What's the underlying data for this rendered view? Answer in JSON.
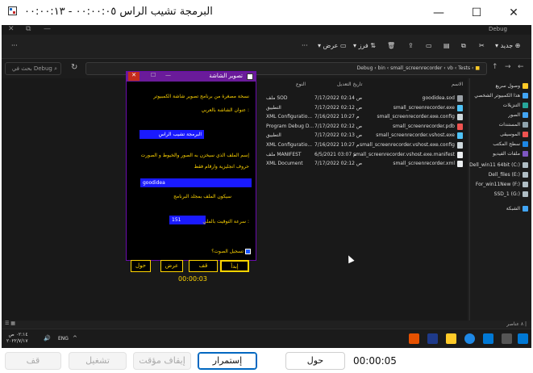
{
  "app": {
    "title": "البرمجة تشيب الراس ٠٠:٠٠:٠٥ - ٠٠:٠٠:١٣",
    "minimize": "—",
    "maximize": "☐",
    "close": "✕"
  },
  "explorer": {
    "tab_title": "Debug",
    "search_placeholder": "بحث في Debug",
    "breadcrumbs": [
      "Debug",
      "bin",
      "small_screenrecorder",
      "vb",
      "Tests"
    ],
    "toolbar": {
      "new_label": "جديد",
      "sort_label": "فرز",
      "view_label": "عرض"
    },
    "columns": {
      "name": "الاسم",
      "modified": "تاريخ التعديل",
      "type": "النوع"
    },
    "files": [
      {
        "name": "goodidea.sod",
        "date": "7/17/2022 02:14 ص",
        "type": "ملف SOD",
        "color": "#9aa0a6"
      },
      {
        "name": "small_screenrecorder.exe",
        "date": "7/17/2022 02:12 ص",
        "type": "التطبيق",
        "color": "#4fc3f7"
      },
      {
        "name": "small_screenrecorder.exe.config",
        "date": "7/16/2022 10:27 م",
        "type": "XML Configuratio...",
        "color": "#cfd8dc"
      },
      {
        "name": "small_screenrecorder.pdb",
        "date": "7/17/2022 02:12 ص",
        "type": "Program Debug D...",
        "color": "#ef5350"
      },
      {
        "name": "small_screenrecorder.vshost.exe",
        "date": "7/17/2022 02:13 ص",
        "type": "التطبيق",
        "color": "#4fc3f7"
      },
      {
        "name": "small_screenrecorder.vshost.exe.config",
        "date": "7/16/2022 10:27 م",
        "type": "XML Configuratio...",
        "color": "#cfd8dc"
      },
      {
        "name": "small_screenrecorder.vshost.exe.manifest",
        "date": "6/5/2021 03:07 م",
        "type": "ملف MANIFEST",
        "color": "#eceff1"
      },
      {
        "name": "small_screenrecorder.xml",
        "date": "7/17/2022 02:12 ص",
        "type": "XML Document",
        "color": "#eceff1"
      }
    ],
    "nav_items": [
      {
        "label": "وصول سريع",
        "color": "#ffca28"
      },
      {
        "label": "هذا الكمبيوتر الشخصي",
        "color": "#42a5f5"
      },
      {
        "label": "التنزيلات",
        "color": "#26a69a"
      },
      {
        "label": "الصور",
        "color": "#42a5f5"
      },
      {
        "label": "المستندات",
        "color": "#90a4ae"
      },
      {
        "label": "الموسيقى",
        "color": "#ef5350"
      },
      {
        "label": "سطح المكتب",
        "color": "#1e88e5"
      },
      {
        "label": "ملفات الفيديو",
        "color": "#7e57c2"
      },
      {
        "label": "Dell_win11 64bit (C:)",
        "color": "#b0bec5"
      },
      {
        "label": "Dell_files (E:)",
        "color": "#b0bec5"
      },
      {
        "label": "For_win11New (F:)",
        "color": "#b0bec5"
      },
      {
        "label": "SSD_1 (G:)",
        "color": "#b0bec5"
      },
      {
        "label": "الشبكة",
        "color": "#42a5f5"
      }
    ],
    "status": "٨ عناصر |",
    "taskbar": {
      "time": "٠٢:١٤ ص",
      "date": "٢٠٢٢/٧/١٧",
      "lang": "ENG"
    }
  },
  "dialog": {
    "title": "تصوير الشاشة",
    "description": "نسخة مصغرة من برنامج تصوير شاشة الكمبيوتر",
    "window_title_label": "عنوان الشاشة بالعربي :",
    "window_title_value": "البرمجة تشيب الراس",
    "file_name_label": "إسم الملف الذي سيخزن به الصور والخيوط و الصورت",
    "file_name_note": "حروف انجليزية وارقام فقط",
    "file_name_value": "goodidea",
    "folder_note": "سيكون الملف بمجلد البرنامج",
    "interval_label": "سرعة التوقيت بالملي :",
    "interval_value": "151",
    "record_audio_label": "تسجيل الصوت؟",
    "buttons": {
      "start": "إبدأ",
      "stop": "قف",
      "show": "عرض",
      "about": "حول"
    },
    "timer": "00:00:03"
  },
  "controls": {
    "stop": "قف",
    "play": "تشغيل",
    "pause": "إيقاف مؤقت",
    "resume": "إستمرار",
    "about": "حول",
    "timer": "00:00:05"
  }
}
